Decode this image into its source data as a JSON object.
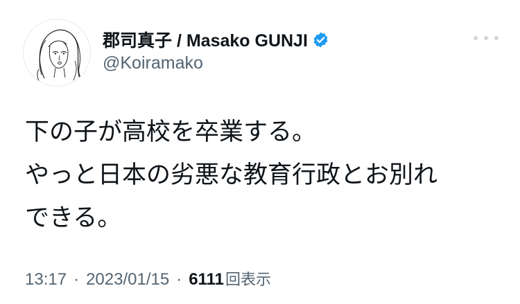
{
  "author": {
    "display_name": "郡司真子 / Masako GUNJI",
    "handle": "@Koiramako",
    "verified": true,
    "verified_color": "#1d9bf0",
    "avatar_icon": "line-drawing-portrait"
  },
  "tweet": {
    "lines": [
      "下の子が高校を卒業する。",
      "やっと日本の劣悪な教育行政とお別れ",
      "できる。"
    ]
  },
  "meta": {
    "time": "13:17",
    "separator": "·",
    "date": "2023/01/15",
    "views_count": "6111",
    "views_label": "回表示"
  },
  "icons": {
    "more": "more-dots-icon",
    "verified": "verified-badge-icon"
  },
  "colors": {
    "text_primary": "#0f1419",
    "text_secondary": "#536471",
    "accent": "#1d9bf0"
  }
}
